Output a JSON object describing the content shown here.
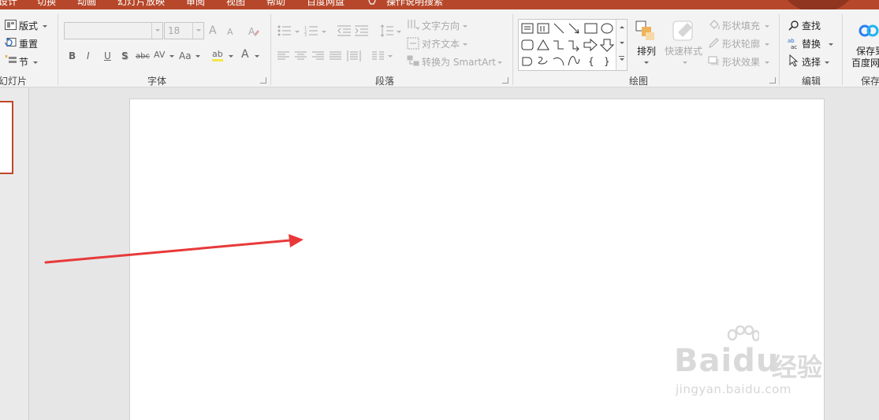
{
  "tabs": [
    "设计",
    "切换",
    "动画",
    "幻灯片放映",
    "审阅",
    "视图",
    "帮助",
    "百度网盘",
    "操作说明搜索"
  ],
  "slides_group": {
    "layout_label": "版式",
    "reset_label": "重置",
    "section_label": "节",
    "group_label": "幻灯片"
  },
  "font_group": {
    "font_name": "",
    "font_size": "18",
    "grow_label": "A",
    "shrink_label": "A",
    "bold": "B",
    "italic": "I",
    "underline": "U",
    "shadow": "S",
    "strike": "abc",
    "spacing": "AV",
    "case": "Aa",
    "highlight": "ab",
    "color": "A",
    "group_label": "字体"
  },
  "paragraph_group": {
    "text_direction": "文字方向",
    "align_text": "对齐文本",
    "convert_smartart": "转换为 SmartArt",
    "group_label": "段落"
  },
  "drawing_group": {
    "arrange": "排列",
    "quick_styles": "快速样式",
    "shape_fill": "形状填充",
    "shape_outline": "形状轮廓",
    "shape_effects": "形状效果",
    "group_label": "绘图"
  },
  "editing_group": {
    "find": "查找",
    "replace": "替换",
    "select": "选择",
    "group_label": "编辑"
  },
  "save_group": {
    "save_line1": "保存到",
    "save_line2": "百度网盘",
    "group_label": "保存"
  },
  "annotation": {
    "arrow_color": "#e8393a"
  },
  "watermark": {
    "brand": "Baidu",
    "jingyan": "经验",
    "url": "jingyan.baidu.com"
  },
  "colors": {
    "accent": "#b7472a",
    "ribbon_bg": "#f3f3f3",
    "workspace_bg": "#e6e6e6"
  }
}
